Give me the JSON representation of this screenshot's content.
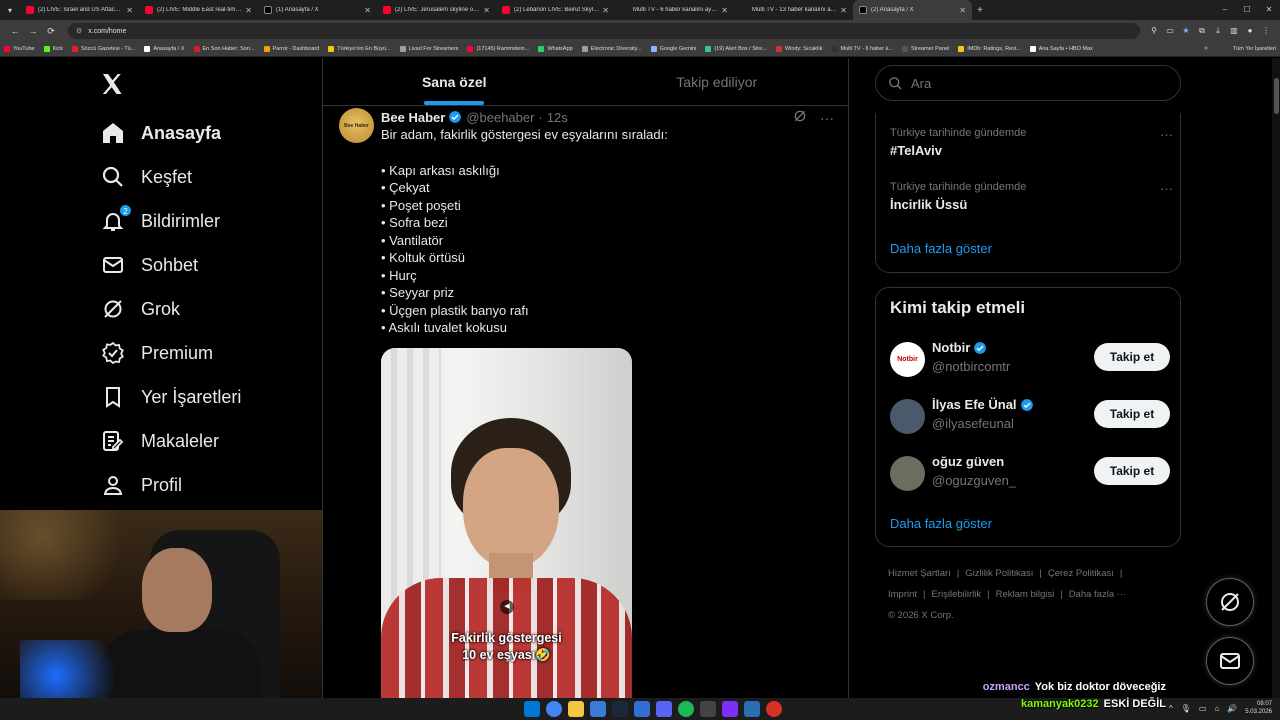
{
  "browser": {
    "tabs": [
      {
        "title": "(2) LIVE: Israel and US Attack Ir...",
        "icon": "youtube-icon"
      },
      {
        "title": "(2) LIVE: Middle East real-time ...",
        "icon": "youtube-icon"
      },
      {
        "title": "(1) Anasayfa / X",
        "icon": "x-icon"
      },
      {
        "title": "(2) LIVE: Jerusalem skyline on D...",
        "icon": "youtube-icon"
      },
      {
        "title": "(2) Lebanon LIVE: Beirut Skylin...",
        "icon": "youtube-icon"
      },
      {
        "title": "Multi TV - 6 haber kanalını ayn...",
        "icon": "none"
      },
      {
        "title": "Multi TV - 13 haber kanalını ayn...",
        "icon": "none"
      },
      {
        "title": "(2) Anasayfa / X",
        "icon": "x-icon",
        "active": true
      }
    ],
    "url": "x.com/home",
    "bookmarks": [
      {
        "label": "YouTube",
        "color": "#ff0033"
      },
      {
        "label": "Kick",
        "color": "#53fc18"
      },
      {
        "label": "Sözcü Gazetesi - Tü...",
        "color": "#e31e24"
      },
      {
        "label": "Anasayfa / X",
        "color": "#ffffff"
      },
      {
        "label": "En Son Haber: Son...",
        "color": "#d91b24"
      },
      {
        "label": "Parrot - Dashboard",
        "color": "#f4a300"
      },
      {
        "label": "Türkiye'nin En Büyü...",
        "color": "#f2c811"
      },
      {
        "label": "Livad For Streamers",
        "color": "#9aa0a6"
      },
      {
        "label": "(17145) Rammstein...",
        "color": "#ff0033"
      },
      {
        "label": "WhatsApp",
        "color": "#25d366"
      },
      {
        "label": "Electronic Diversity...",
        "color": "#9aa0a6"
      },
      {
        "label": "Google Gemini",
        "color": "#8ab4f8"
      },
      {
        "label": "(19) Alert Box / Stre...",
        "color": "#31c3a2"
      },
      {
        "label": "Windy: Sıcaklık",
        "color": "#d03030"
      },
      {
        "label": "Multi TV - 6 haber k...",
        "color": "#333333"
      },
      {
        "label": "Streamer Panel",
        "color": "#555555"
      },
      {
        "label": "IMDb: Ratings, Revi...",
        "color": "#f5c518"
      },
      {
        "label": "Ana Sayfa • HBO Max",
        "color": "#ffffff"
      }
    ],
    "all_bookmarks": "Tüm Yer İşaretleri"
  },
  "nav": {
    "items": [
      {
        "label": "Anasayfa",
        "icon": "home-icon",
        "active": true
      },
      {
        "label": "Keşfet",
        "icon": "search-icon"
      },
      {
        "label": "Bildirimler",
        "icon": "bell-icon",
        "badge": "2"
      },
      {
        "label": "Sohbet",
        "icon": "mail-icon"
      },
      {
        "label": "Grok",
        "icon": "grok-icon"
      },
      {
        "label": "Premium",
        "icon": "premium-icon"
      },
      {
        "label": "Yer İşaretleri",
        "icon": "bookmark-icon"
      },
      {
        "label": "Makaleler",
        "icon": "article-icon"
      },
      {
        "label": "Profil",
        "icon": "profile-icon"
      }
    ]
  },
  "feed": {
    "tabs": [
      "Sana özel",
      "Takip ediliyor"
    ],
    "tweet": {
      "avatar_text": "Bee Haber",
      "name": "Bee Haber",
      "handle": "@beehaber",
      "time": "12s",
      "intro": "Bir adam, fakirlik göstergesi ev eşyalarını sıraladı:",
      "items": [
        "• Kapı arkası askılığı",
        "• Çekyat",
        "• Poşet poşeti",
        "• Sofra bezi",
        "• Vantilatör",
        "• Koltuk örtüsü",
        "• Hurç",
        "• Seyyar priz",
        "• Üçgen plastik banyo rafı",
        "• Askılı tuvalet kokusu"
      ],
      "video_caption_line1": "Fakirlik göstergesi",
      "video_caption_line2": "10 ev eşyası🤣"
    }
  },
  "right": {
    "search_placeholder": "Ara",
    "trends": [
      {
        "context": "Türkiye tarihinde gündemde",
        "name": "#TelAviv"
      },
      {
        "context": "Türkiye tarihinde gündemde",
        "name": "İncirlik Üssü"
      }
    ],
    "show_more": "Daha fazla göster",
    "who_title": "Kimi takip etmeli",
    "who": [
      {
        "name": "Notbir",
        "handle": "@notbircomtr",
        "verified": true,
        "avatar_color": "#ffffff",
        "avatar_text": "Notbir"
      },
      {
        "name": "İlyas Efe Ünal",
        "handle": "@ilyasefeunal",
        "verified": true,
        "avatar_color": "#4a5a6a"
      },
      {
        "name": "oğuz güven",
        "handle": "@oguzguven_",
        "verified": false,
        "avatar_color": "#6b6d60"
      }
    ],
    "follow_label": "Takip et",
    "who_show_more": "Daha fazla göster",
    "footer": {
      "line1": [
        "Hizmet Şartları",
        "|",
        "Gizlilik Politikası",
        "|",
        "Çerez Politikası",
        "|"
      ],
      "line2": [
        "Imprint",
        "|",
        "Erişilebilirlik",
        "|",
        "Reklam bilgisi",
        "|",
        "Daha fazla ···"
      ],
      "copyright": "© 2026 X Corp."
    }
  },
  "chat": [
    {
      "user": "ozmancc",
      "message": "Yok biz doktor döveceğiz",
      "user_color": "#c9a0ff"
    },
    {
      "user": "kamanyak0232",
      "message": "ESKİ DEĞİL",
      "user_color": "#7cfc00"
    }
  ],
  "taskbar": {
    "time": "08:07",
    "date": "5.03.2026"
  },
  "colors": {
    "accent": "#1d9bf0",
    "background": "#000000",
    "border": "#2f3336",
    "muted_text": "#71767b"
  }
}
